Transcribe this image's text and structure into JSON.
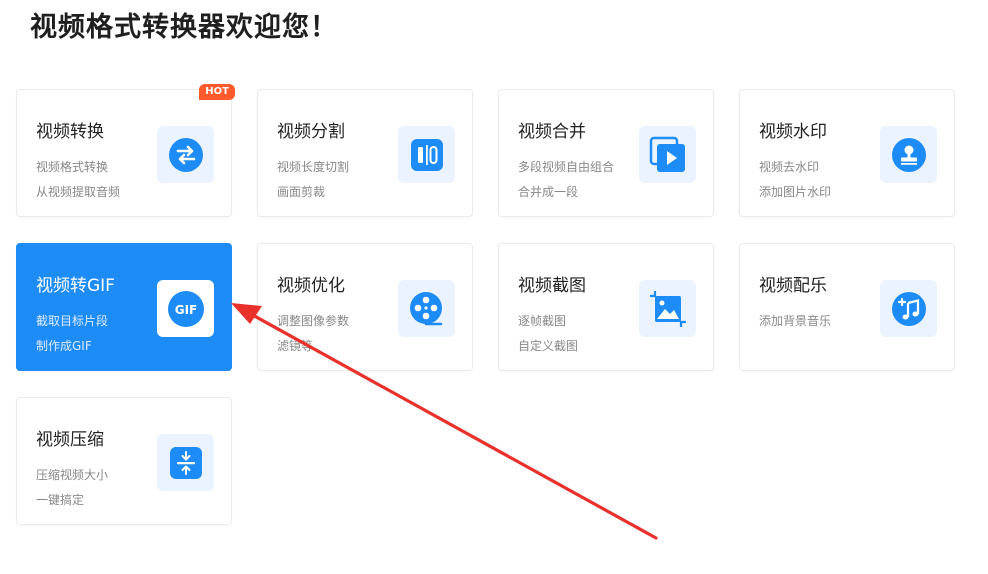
{
  "page": {
    "title": "视频格式转换器欢迎您！"
  },
  "colors": {
    "accent": "#1e8cf7",
    "hot": "#ff5a2b",
    "annotation_arrow": "#e8312a"
  },
  "cards": [
    {
      "title": "视频转换",
      "line1": "视频格式转换",
      "line2": "从视频提取音频",
      "icon": "swap-icon",
      "badge": "HOT"
    },
    {
      "title": "视频分割",
      "line1": "视频长度切割",
      "line2": "画面剪裁",
      "icon": "split-icon"
    },
    {
      "title": "视频合并",
      "line1": "多段视频自由组合",
      "line2": "合并成一段",
      "icon": "merge-play-icon"
    },
    {
      "title": "视频水印",
      "line1": "视频去水印",
      "line2": "添加图片水印",
      "icon": "stamp-icon"
    },
    {
      "title": "视频转GIF",
      "line1": "截取目标片段",
      "line2": "制作成GIF",
      "icon": "gif-icon",
      "icon_text": "GIF",
      "active": true
    },
    {
      "title": "视频优化",
      "line1": "调整图像参数",
      "line2": "滤镜等",
      "icon": "film-reel-icon"
    },
    {
      "title": "视频截图",
      "line1": "逐帧截图",
      "line2": "自定义截图",
      "icon": "crop-image-icon"
    },
    {
      "title": "视频配乐",
      "line1": "添加背景音乐",
      "icon": "music-add-icon"
    },
    {
      "title": "视频压缩",
      "line1": "压缩视频大小",
      "line2": "一键搞定",
      "icon": "compress-icon"
    }
  ]
}
